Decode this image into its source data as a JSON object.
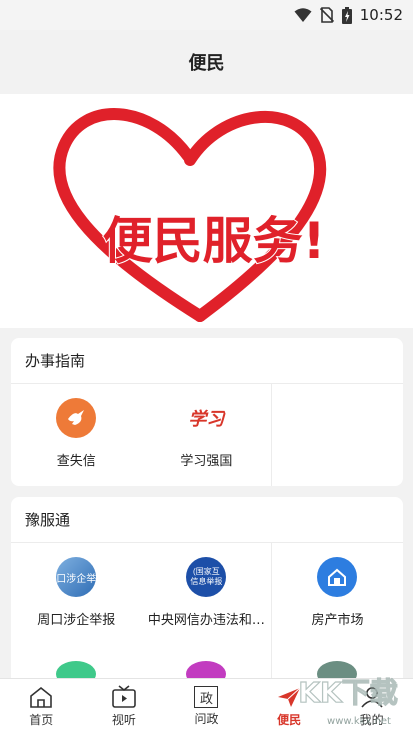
{
  "status_bar": {
    "time": "10:52",
    "icons": [
      "wifi-icon",
      "no-sim-icon",
      "battery-icon"
    ]
  },
  "header": {
    "title": "便民"
  },
  "banner": {
    "text": "便民服务!",
    "color": "#e0212a"
  },
  "sections": {
    "guide": {
      "title": "办事指南",
      "items": [
        {
          "label": "查失信",
          "icon": "dove-icon",
          "color": "#ee7a38"
        },
        {
          "label": "学习强国",
          "logo_text": "学习",
          "icon": "xuexi-logo-icon",
          "color": "#d8362a"
        }
      ]
    },
    "yufutong": {
      "title": "豫服通",
      "items": [
        {
          "label": "周口涉企举报",
          "logo_text": "口涉企举",
          "icon": "report-logo-icon",
          "color": "#2f6db5"
        },
        {
          "label": "中央网信办违法和…",
          "logo_text": "(国家互 信息举报",
          "icon": "cac-report-logo-icon",
          "color": "#1d4fa8"
        },
        {
          "label": "房产市场",
          "icon": "house-icon",
          "color": "#2d7de0"
        }
      ],
      "partial_row_colors": [
        "#3fc98a",
        "#c23cc0",
        "#6b8e82"
      ]
    }
  },
  "tabbar": {
    "tabs": [
      {
        "label": "首页",
        "icon": "home-icon"
      },
      {
        "label": "视听",
        "icon": "tv-icon"
      },
      {
        "label": "问政",
        "icon_text": "政",
        "icon": "government-icon"
      },
      {
        "label": "便民",
        "icon": "paper-plane-icon",
        "active": true
      },
      {
        "label": "我的",
        "icon": "user-icon"
      }
    ],
    "active_color": "#d8362a"
  },
  "watermark": {
    "text": "KK下载",
    "url": "www.kkx.net"
  }
}
